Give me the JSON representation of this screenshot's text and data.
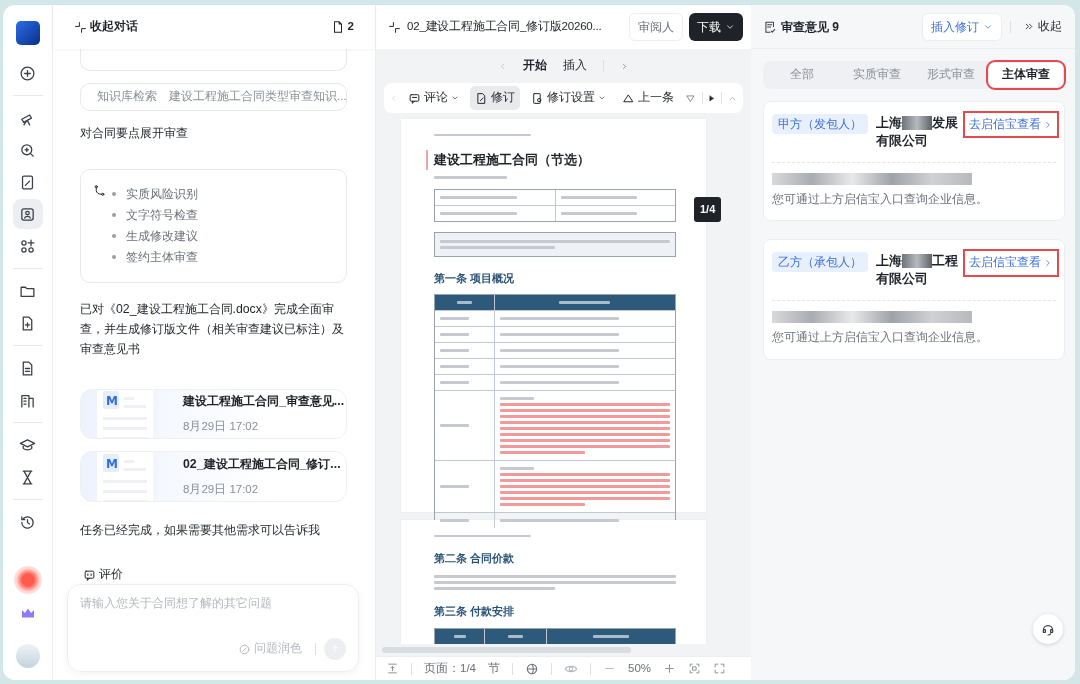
{
  "rail": {
    "groups": [
      [
        {
          "kind": "new",
          "selected": false
        }
      ],
      [
        {
          "kind": "telescope",
          "selected": false
        },
        {
          "kind": "zoom",
          "selected": false
        },
        {
          "kind": "edit",
          "selected": false
        },
        {
          "kind": "scan",
          "selected": true
        },
        {
          "kind": "apps",
          "selected": false
        }
      ],
      [
        {
          "kind": "folder",
          "selected": false
        },
        {
          "kind": "docplus",
          "selected": false
        }
      ],
      [
        {
          "kind": "doc",
          "selected": false
        },
        {
          "kind": "building",
          "selected": false
        }
      ],
      [
        {
          "kind": "cap",
          "selected": false
        },
        {
          "kind": "hourglass",
          "selected": false
        }
      ],
      [
        {
          "kind": "history",
          "selected": false
        }
      ]
    ]
  },
  "chat": {
    "header": {
      "title": "收起对话",
      "file_count": "2"
    },
    "search": {
      "label": "知识库检索",
      "query": "建设工程施工合同类型审查知识..."
    },
    "intro": "对合同要点展开审查",
    "steps": [
      "实质风险识别",
      "文字符号检查",
      "生成修改建议",
      "签约主体审查"
    ],
    "summary": "已对《02_建设工程施工合同.docx》完成全面审查，并生成修订版文件（相关审查建议已标注）及审查意见书",
    "files": [
      {
        "icon_letter": "M",
        "name": "建设工程施工合同_审查意见...",
        "time": "8月29日 17:02"
      },
      {
        "icon_letter": "M",
        "name": "02_建设工程施工合同_修订...",
        "time": "8月29日 17:02"
      }
    ],
    "done": "任务已经完成，如果需要其他需求可以告诉我",
    "rate": "评价",
    "input": {
      "placeholder": "请输入您关于合同想了解的其它问题",
      "polish": "问题润色"
    }
  },
  "document": {
    "title": "02_建设工程施工合同_修订版20260...",
    "reviewer": "审阅人",
    "download": "下载",
    "menu": [
      {
        "label": "开始",
        "selected": true
      },
      {
        "label": "插入",
        "selected": false
      }
    ],
    "toolbar": [
      {
        "kind": "comment",
        "label": "评论",
        "selected": false
      },
      {
        "kind": "revise",
        "label": "修订",
        "selected": true
      },
      {
        "kind": "settings",
        "label": "修订设置",
        "selected": false
      },
      {
        "kind": "prev",
        "label": "上一条",
        "selected": false
      }
    ],
    "pages": [
      {
        "title": "建设工程施工合同（节选）",
        "sections": [
          {
            "heading": "第一条  项目概况",
            "kind": "table"
          }
        ]
      },
      {
        "sections": [
          {
            "heading": "第二条  合同价款",
            "kind": "paragraph"
          },
          {
            "heading": "第三条  付款安排",
            "kind": "table"
          }
        ]
      }
    ],
    "page_badge": "1/4",
    "status": {
      "page": "页面：1/4",
      "section": "节",
      "zoom": "50%"
    }
  },
  "review": {
    "title": "审查意见 9",
    "insert": "插入修订",
    "collapse": "收起",
    "tabs": [
      {
        "label": "全部",
        "selected": false,
        "highlighted": false
      },
      {
        "label": "实质审查",
        "selected": false,
        "highlighted": false
      },
      {
        "label": "形式审查",
        "selected": false,
        "highlighted": false
      },
      {
        "label": "主体审查",
        "selected": true,
        "highlighted": true
      }
    ],
    "cards": [
      {
        "role": "甲方（发包人）",
        "name_start": "上海",
        "name_end": "发展",
        "name_line2": "有限公司",
        "link": "去启信宝查看",
        "highlighted": true,
        "note": "您可通过上方启信宝入口查询企业信息。"
      },
      {
        "role": "乙方（承包人）",
        "name_start": "上海",
        "name_end": "工程",
        "name_line2": "有限公司",
        "link": "去启信宝查看",
        "highlighted": true,
        "note": "您可通过上方启信宝入口查询企业信息。"
      }
    ]
  }
}
